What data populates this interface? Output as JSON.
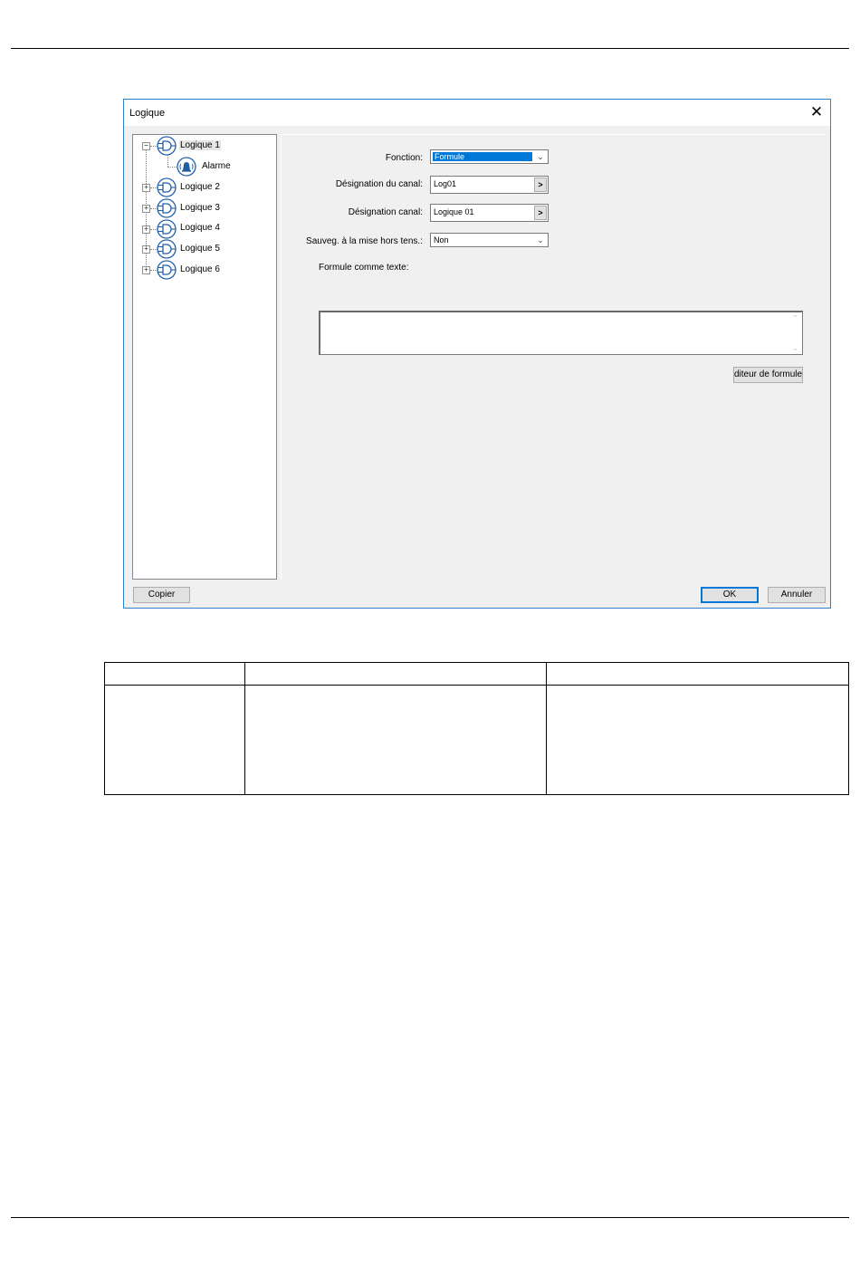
{
  "dialog": {
    "title": "Logique",
    "close_glyph": "✕",
    "tree": {
      "items": [
        {
          "label": "Logique 1",
          "expanded": true,
          "icon": "logic-gate-icon",
          "children": [
            {
              "label": "Alarme",
              "icon": "alarm-bell-icon"
            }
          ]
        },
        {
          "label": "Logique 2",
          "expanded": false,
          "icon": "logic-gate-icon"
        },
        {
          "label": "Logique 3",
          "expanded": false,
          "icon": "logic-gate-icon"
        },
        {
          "label": "Logique 4",
          "expanded": false,
          "icon": "logic-gate-icon"
        },
        {
          "label": "Logique 5",
          "expanded": false,
          "icon": "logic-gate-icon"
        },
        {
          "label": "Logique 6",
          "expanded": false,
          "icon": "logic-gate-icon"
        }
      ],
      "expander_minus": "−",
      "expander_plus": "+"
    },
    "form": {
      "fonction": {
        "label": "Fonction:",
        "value": "Formule"
      },
      "designation_du_canal": {
        "label": "Désignation du canal:",
        "value": "Log01",
        "button": ">"
      },
      "designation_canal": {
        "label": "Désignation canal:",
        "value": "Logique 01",
        "button": ">"
      },
      "sauveg": {
        "label": "Sauveg. à la mise hors tens.:",
        "value": "Non"
      },
      "formule_texte": {
        "label": "Formule comme texte:",
        "value": ""
      },
      "editor_button": "diteur de formules"
    },
    "footer": {
      "copy_button": "Copier",
      "ok_button": "OK",
      "cancel_button": "Annuler"
    },
    "colors": {
      "accent": "#0078d7",
      "border": "#2f7fcf",
      "icon": "#1f5fa8"
    }
  },
  "table": {
    "header": [
      "",
      "",
      ""
    ],
    "rows": [
      [
        "",
        "",
        ""
      ]
    ]
  }
}
